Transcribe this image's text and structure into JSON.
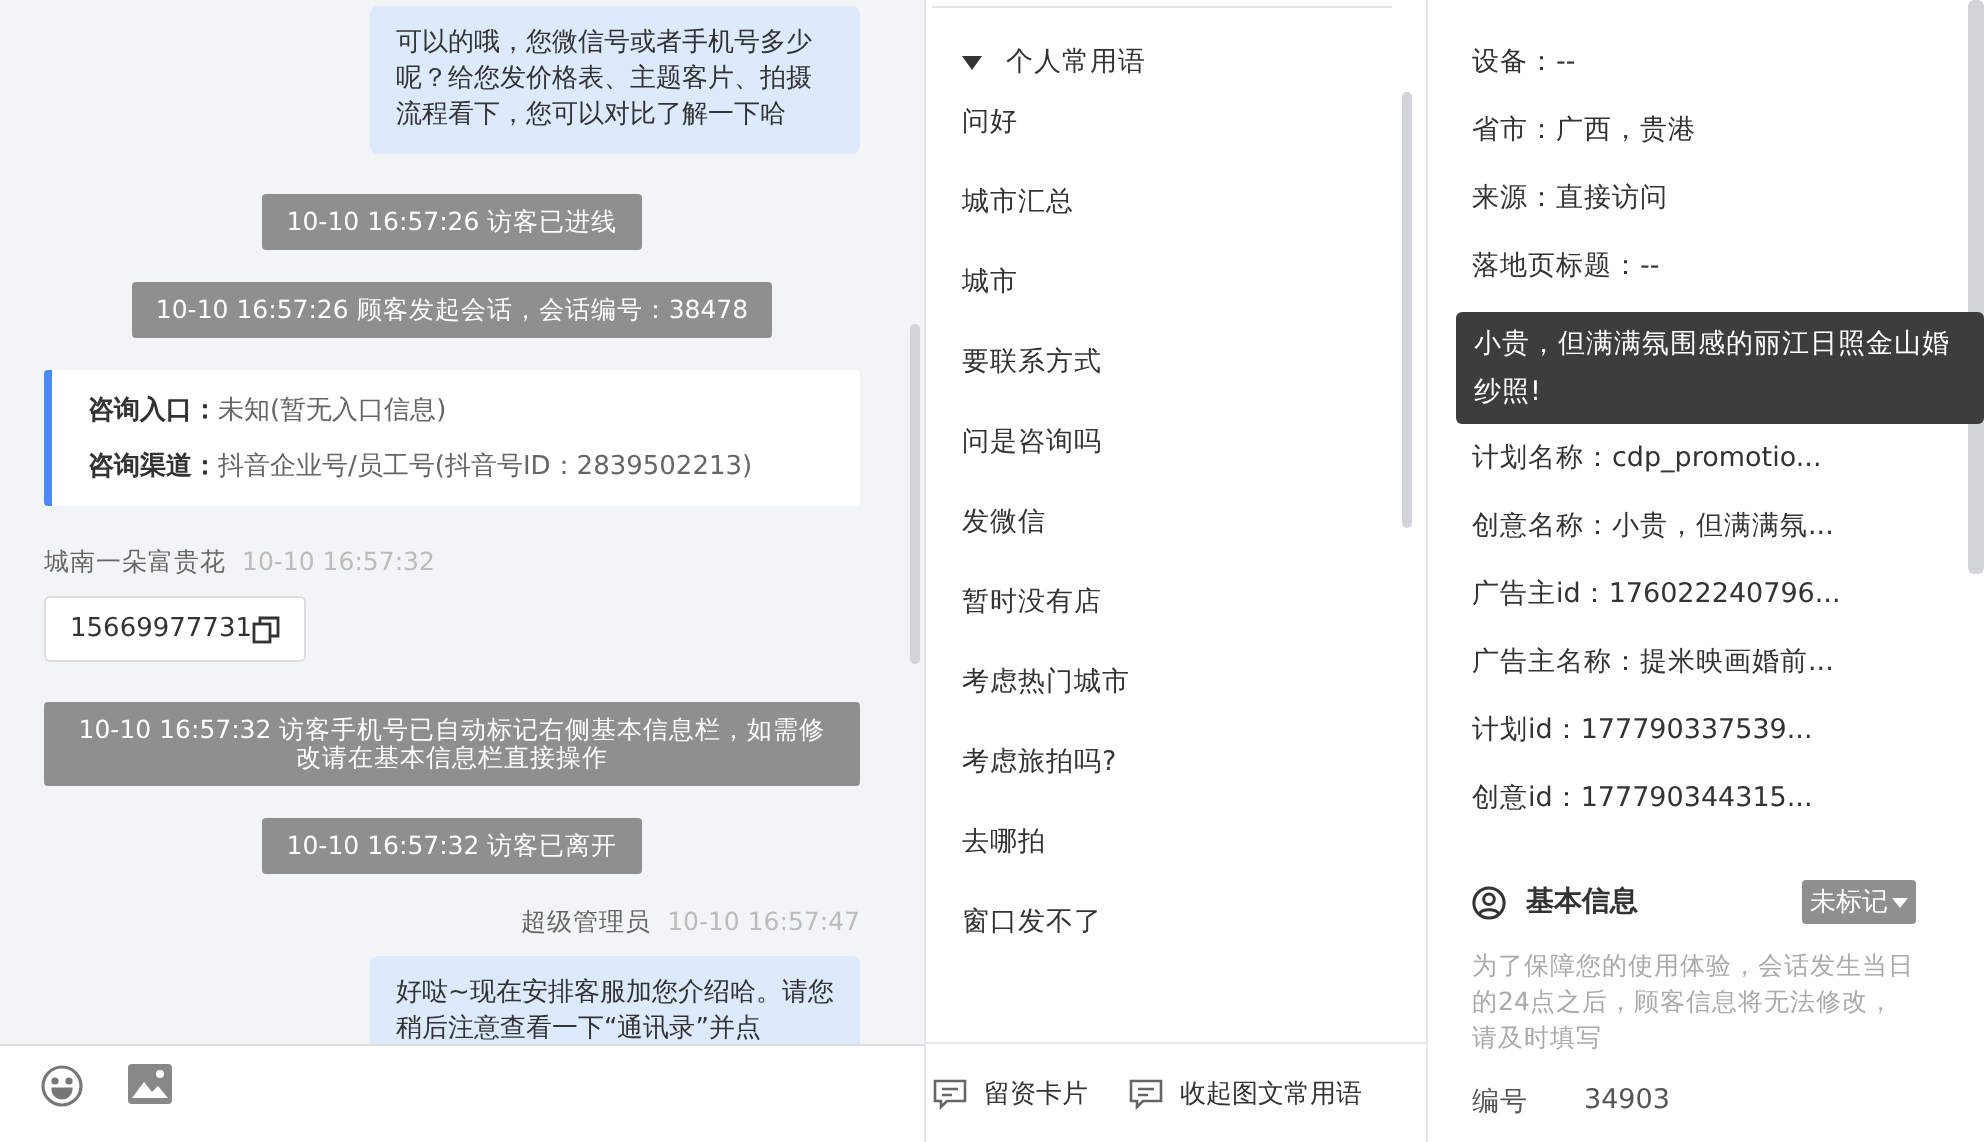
{
  "chat": {
    "messages": [
      {
        "kind": "agent_bubble",
        "text": "可以的哦，您微信号或者手机号多少呢？给您发价格表、主题客片、拍摄流程看下，您可以对比了解一下哈"
      },
      {
        "kind": "system",
        "text": "10-10 16:57:26 访客已进线"
      },
      {
        "kind": "system",
        "text": "10-10 16:57:26 顾客发起会话，会话编号：38478"
      },
      {
        "kind": "source_card",
        "lines": [
          {
            "label": "咨询入口：",
            "value": "未知(暂无入口信息)"
          },
          {
            "label": "咨询渠道：",
            "value": "抖音企业号/员工号(抖音号ID：2839502213)"
          }
        ]
      },
      {
        "kind": "visitor_meta",
        "sender": "城南一朵富贵花",
        "time": "10-10 16:57:32"
      },
      {
        "kind": "phone_card",
        "text": "15669977731"
      },
      {
        "kind": "system",
        "text": "10-10 16:57:32 访客手机号已自动标记右侧基本信息栏，如需修改请在基本信息栏直接操作"
      },
      {
        "kind": "system",
        "text": "10-10 16:57:32 访客已离开"
      },
      {
        "kind": "agent_meta",
        "sender": "超级管理员",
        "time": "10-10 16:57:47"
      },
      {
        "kind": "agent_bubble",
        "text": "好哒~现在安排客服加您介绍哈。请您稍后注意查看一下“通讯录”并点"
      }
    ]
  },
  "phrases": {
    "group": {
      "label": "个人常用语",
      "expanded": true
    },
    "items": [
      "问好",
      "城市汇总",
      "城市",
      "要联系方式",
      "问是咨询吗",
      "发微信",
      "暂时没有店",
      "考虑热门城市",
      "考虑旅拍吗?",
      "去哪拍",
      "窗口发不了"
    ],
    "actions": [
      "留资卡片",
      "收起图文常用语"
    ]
  },
  "visitor_info": {
    "rows_above": [
      "设备：--",
      "省市：广西，贵港",
      "来源：直接访问",
      "落地页标题：--"
    ],
    "tooltip": "小贵，但满满氛围感的丽江日照金山婚纱照!",
    "rows_below": [
      "计划名称：cdp_promotio...",
      "创意名称：小贵，但满满氛...",
      "广告主id：176022240796...",
      "广告主名称：提米映画婚前...",
      "计划id：177790337539...",
      "创意id：177790344315..."
    ]
  },
  "basic_info": {
    "title": "基本信息",
    "tag": "未标记",
    "notice": "为了保障您的使用体验，会话发生当日的24点之后，顾客信息将无法修改，请及时填写",
    "fields": [
      {
        "label": "编号",
        "value": "34903"
      }
    ]
  }
}
